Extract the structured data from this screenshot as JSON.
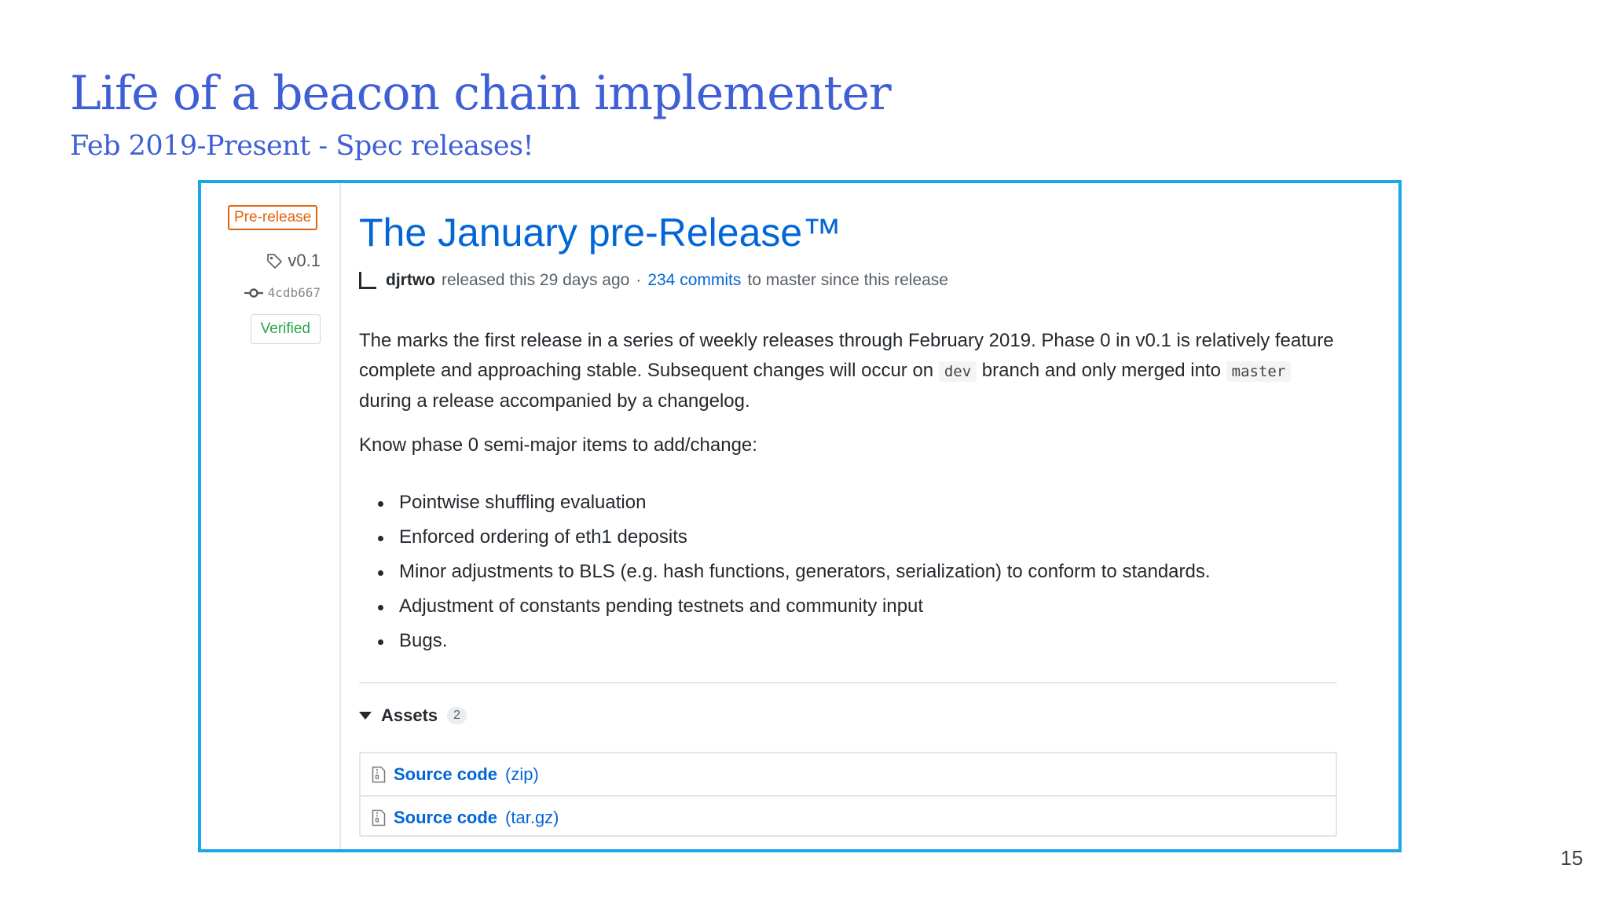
{
  "slide": {
    "title": "Life of a beacon chain implementer",
    "subtitle": "Feb 2019-Present - Spec releases!",
    "page_number": "15"
  },
  "release": {
    "badge": "Pre-release",
    "tag": "v0.1",
    "commit": "4cdb667",
    "verified": "Verified",
    "title": "The January pre-Release™",
    "author": "djrtwo",
    "released_text": "released this 29 days ago",
    "separator": "·",
    "commits_link": "234 commits",
    "commits_suffix": "to master since this release",
    "paragraph": {
      "part1": "The marks the first release in a series of weekly releases through February 2019. Phase 0 in v0.1 is relatively feature complete and approaching stable. Subsequent changes will occur on ",
      "code1": "dev",
      "part2": " branch and only merged into ",
      "code2": "master",
      "part3": " during a release accompanied by a changelog."
    },
    "know_heading": "Know phase 0 semi-major items to add/change:",
    "items": [
      "Pointwise shuffling evaluation",
      "Enforced ordering of eth1 deposits",
      "Minor adjustments to BLS (e.g. hash functions, generators, serialization) to conform to standards.",
      "Adjustment of constants pending testnets and community input",
      "Bugs."
    ],
    "assets": {
      "label": "Assets",
      "count": "2",
      "files": [
        {
          "name": "Source code",
          "ext": "(zip)"
        },
        {
          "name": "Source code",
          "ext": "(tar.gz)"
        }
      ]
    }
  },
  "colors": {
    "title_blue": "#3f5fd6",
    "frame_border": "#1aa7e6",
    "link_blue": "#0366d6",
    "prerelease_orange": "#e36209",
    "verified_green": "#28a745"
  },
  "icons": [
    "tag-icon",
    "commit-icon",
    "caret-down-icon",
    "file-zip-icon"
  ]
}
